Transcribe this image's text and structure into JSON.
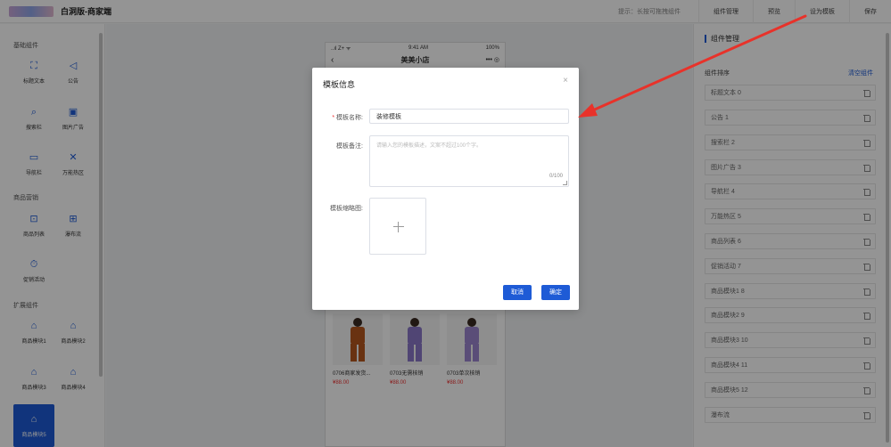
{
  "header": {
    "title": "白洞版-商家端",
    "hint": "提示：长按可拖拽组件",
    "buttons": [
      "组件管理",
      "预览",
      "设为模板",
      "保存"
    ]
  },
  "sidebar": {
    "groups": [
      "基础组件",
      "商品营销",
      "扩展组件"
    ],
    "items": [
      {
        "label": "标题文本",
        "icon": "title-text-icon"
      },
      {
        "label": "公告",
        "icon": "announcement-icon"
      },
      {
        "label": "搜索栏",
        "icon": "search-bar-icon"
      },
      {
        "label": "图片广告",
        "icon": "image-ad-icon"
      },
      {
        "label": "导航栏",
        "icon": "nav-bar-icon"
      },
      {
        "label": "万能热区",
        "icon": "hotspot-icon"
      },
      {
        "label": "商品列表",
        "icon": "product-list-icon"
      },
      {
        "label": "瀑布流",
        "icon": "waterfall-icon"
      },
      {
        "label": "促销活动",
        "icon": "promotion-icon"
      },
      {
        "label": "商品模块1",
        "icon": "shop-module-icon"
      },
      {
        "label": "商品模块2",
        "icon": "shop-module-icon"
      },
      {
        "label": "商品模块3",
        "icon": "shop-module-icon"
      },
      {
        "label": "商品模块4",
        "icon": "shop-module-icon"
      },
      {
        "label": "商品模块5",
        "icon": "shop-module-icon"
      }
    ]
  },
  "phone": {
    "status_left": "..ıl Z+ ᯤ",
    "time": "9:41 AM",
    "battery": "100%",
    "shop_name": "美美小店",
    "products": [
      {
        "name": "0706商家发货...",
        "price": "¥88.00",
        "color": "#b5561e"
      },
      {
        "name": "0703无需核销",
        "price": "¥88.00",
        "color": "#8b78c9"
      },
      {
        "name": "0703单次核销",
        "price": "¥88.00",
        "color": "#9c86cf"
      }
    ]
  },
  "right_panel": {
    "title": "组件管理",
    "sort_label": "组件排序",
    "clear_label": "清空组件",
    "rows": [
      "标题文本 0",
      "公告 1",
      "搜索栏 2",
      "图片广告 3",
      "导航栏 4",
      "万能热区 5",
      "商品列表 6",
      "促销活动 7",
      "商品模块1 8",
      "商品模块2 9",
      "商品模块3 10",
      "商品模块4 11",
      "商品模块5 12",
      "瀑布流"
    ]
  },
  "modal": {
    "title": "模板信息",
    "close": "×",
    "name_label": "模板名称:",
    "name_value": "装修模板",
    "remark_label": "模板备注:",
    "remark_placeholder": "请输入您的模板描述，文案不超过100个字。",
    "remark_count": "0/100",
    "thumb_label": "模板缩略图:",
    "cancel": "取消",
    "confirm": "确定"
  },
  "colors": {
    "accent": "#1e5bd6",
    "arrow": "#e8322a"
  }
}
